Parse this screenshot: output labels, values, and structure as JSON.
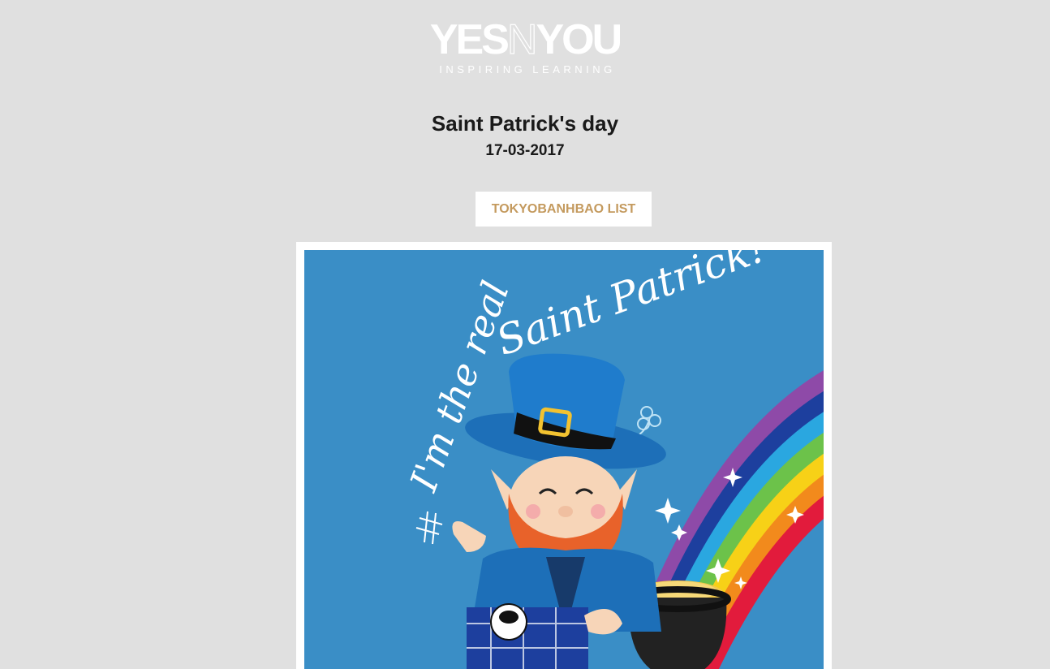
{
  "header": {
    "logo_text_left": "YES",
    "logo_text_mid": "N",
    "logo_text_right": "YOU",
    "tagline": "INSPIRING LEARNING"
  },
  "post": {
    "title": "Saint Patrick's day",
    "date": "17-03-2017"
  },
  "actions": {
    "list_button_label": "TOKYOBANHBAO LIST"
  },
  "illustration": {
    "caption_line1": "I'm the real",
    "caption_line2": "Saint Patrick!",
    "background_color": "#3a8ec6"
  },
  "colors": {
    "page_background": "#e0e0e0",
    "button_text": "#c49a5e",
    "title_text": "#1a1a1a"
  }
}
